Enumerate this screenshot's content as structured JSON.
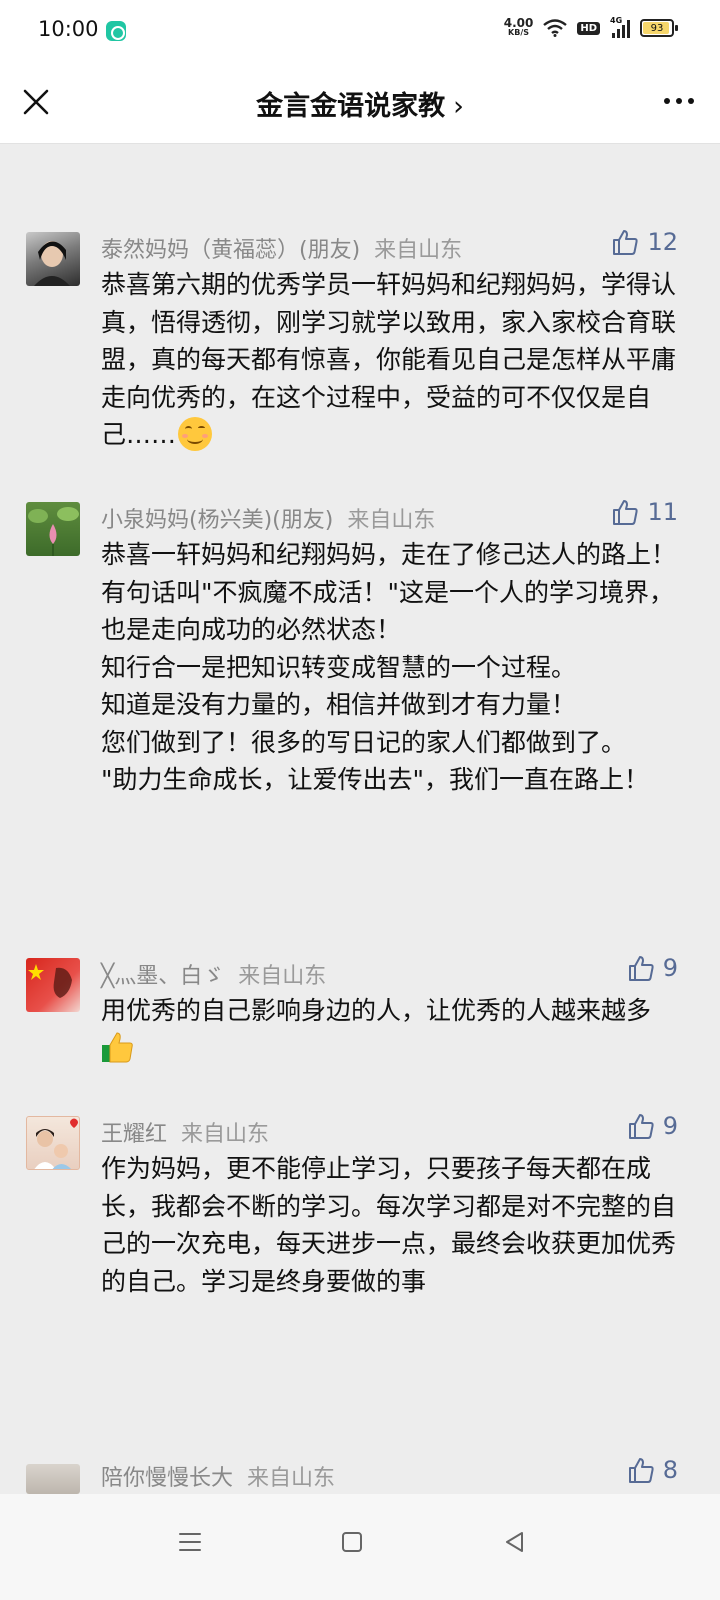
{
  "status_bar": {
    "time": "10:00",
    "net_speed_value": "4.00",
    "net_speed_unit": "KB/S",
    "hd_label": "HD",
    "network_label": "4G",
    "battery_level": "93"
  },
  "header": {
    "title": "金言金语说家教",
    "chevron": "›"
  },
  "comments": [
    {
      "author": "泰然妈妈（黄福蕊）(朋友)",
      "location": "来自山东",
      "likes": "12",
      "text": "恭喜第六期的优秀学员一轩妈妈和纪翔妈妈，学得认真，悟得透彻，刚学习就学以致用，家入家校合育联盟，真的每天都有惊喜，你能看见自己是怎样从平庸走向优秀的，在这个过程中，受益的可不仅仅是自己……"
    },
    {
      "author": "小泉妈妈(杨兴美)(朋友)",
      "location": "来自山东",
      "likes": "11",
      "text": "恭喜一轩妈妈和纪翔妈妈，走在了修己达人的路上！\n有句话叫\"不疯魔不成活！\"这是一个人的学习境界，也是走向成功的必然状态！\n知行合一是把知识转变成智慧的一个过程。\n知道是没有力量的，相信并做到才有力量！\n您们做到了！很多的写日记的家人们都做到了。\n\"助力生命成长，让爱传出去\"，我们一直在路上！"
    },
    {
      "author": "╳灬墨、白ゞ",
      "location": "来自山东",
      "likes": "9",
      "text": "用优秀的自己影响身边的人，让优秀的人越来越多"
    },
    {
      "author": "王耀红",
      "location": "来自山东",
      "likes": "9",
      "text": "作为妈妈，更不能停止学习，只要孩子每天都在成长，我都会不断的学习。每次学习都是对不完整的自己的一次充电，每天进步一点，最终会收获更加优秀的自己。学习是终身要做的事"
    },
    {
      "author": "陪你慢慢长大",
      "location": "来自山东",
      "likes": "8",
      "text": ""
    }
  ],
  "icons": {
    "close": "close-icon",
    "more": "more-icon",
    "like": "thumbs-up-icon",
    "nav_menu": "menu-icon",
    "nav_home": "square-home-icon",
    "nav_back": "triangle-back-icon"
  },
  "colors": {
    "like_blue": "#576b95",
    "page_bg": "#ededed",
    "meta_gray": "#888888"
  }
}
